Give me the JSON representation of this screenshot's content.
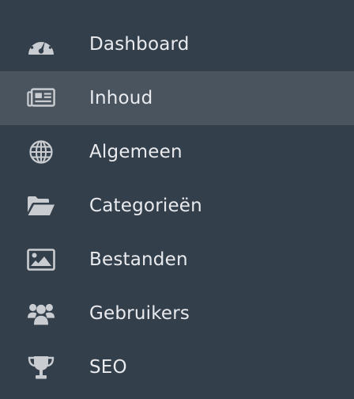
{
  "sidebar": {
    "items": [
      {
        "label": "Dashboard",
        "icon": "dashboard-gauge-icon",
        "active": false
      },
      {
        "label": "Inhoud",
        "icon": "newspaper-icon",
        "active": true
      },
      {
        "label": "Algemeen",
        "icon": "globe-icon",
        "active": false
      },
      {
        "label": "Categorieën",
        "icon": "folder-open-icon",
        "active": false
      },
      {
        "label": "Bestanden",
        "icon": "image-icon",
        "active": false
      },
      {
        "label": "Gebruikers",
        "icon": "users-icon",
        "active": false
      },
      {
        "label": "SEO",
        "icon": "trophy-icon",
        "active": false
      }
    ]
  },
  "colors": {
    "background": "#343f4c",
    "active_background": "#4a545f",
    "text": "#e9ebee",
    "icon": "#c9ccd0"
  }
}
